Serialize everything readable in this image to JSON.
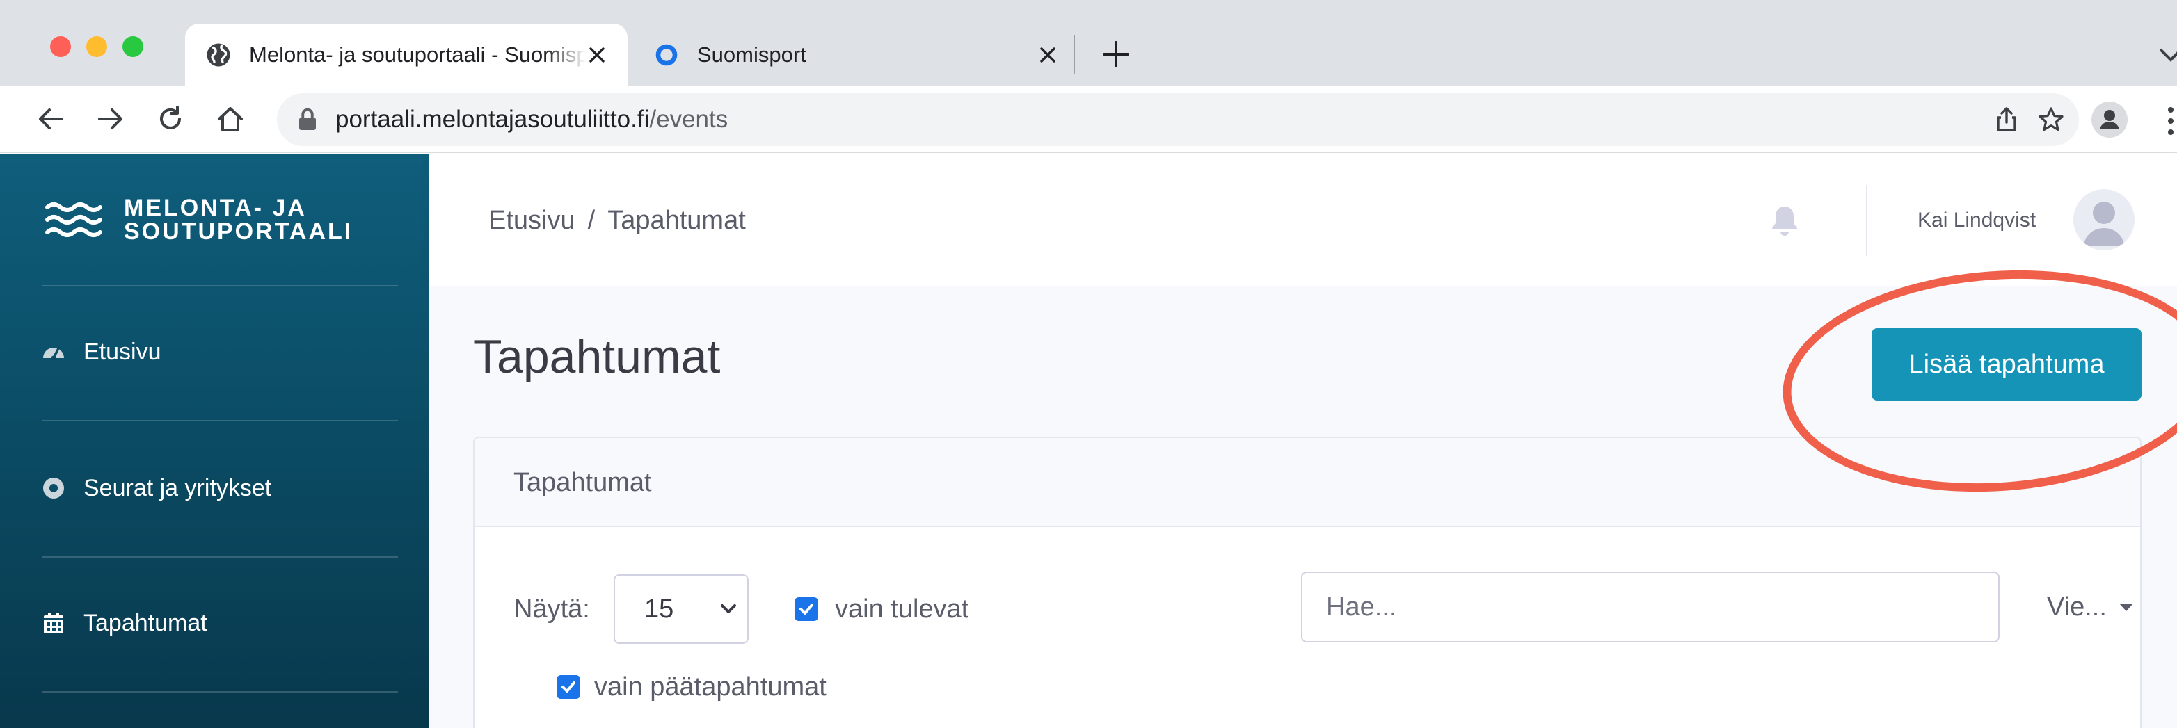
{
  "browser": {
    "tabs": [
      {
        "title": "Melonta- ja soutuportaali - Suomisport",
        "active": true,
        "favicon": "globe-icon"
      },
      {
        "title": "Suomisport",
        "active": false,
        "favicon": "suomisport-ring-icon"
      }
    ],
    "address": {
      "domain": "portaali.melontajasoutuliitto.fi",
      "path": "/events"
    }
  },
  "sidebar": {
    "brand": {
      "line1": "MELONTA- JA",
      "line2": "SOUTUPORTAALI"
    },
    "items": [
      {
        "label": "Etusivu",
        "icon": "dashboard-icon"
      },
      {
        "label": "Seurat ja yritykset",
        "icon": "circle-dot-icon"
      },
      {
        "label": "Tapahtumat",
        "icon": "calendar-icon"
      }
    ]
  },
  "topbar": {
    "breadcrumb": {
      "home": "Etusivu",
      "separator": "/",
      "current": "Tapahtumat"
    },
    "user_name": "Kai Lindqvist"
  },
  "main": {
    "title": "Tapahtumat",
    "add_button": "Lisää tapahtuma",
    "card": {
      "title": "Tapahtumat",
      "show_label": "Näytä:",
      "page_size": "15",
      "upcoming_only": {
        "label": "vain tulevat",
        "checked": true
      },
      "main_events_only": {
        "label": "vain päätapahtumat",
        "checked": true
      },
      "search_placeholder": "Hae...",
      "export_label": "Vie..."
    }
  },
  "colors": {
    "sidebar": "#0b4d66",
    "primary_button": "#1694b8",
    "annotation": "#ef5f4a",
    "checkbox": "#1a73e8"
  }
}
